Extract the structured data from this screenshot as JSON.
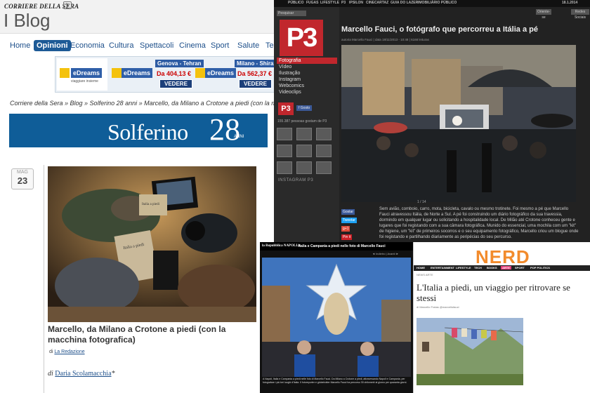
{
  "corriere": {
    "masthead": "CORRIERE DELLA SERA",
    "blog_title": "I Blog",
    "nav": [
      "Home",
      "Opinioni",
      "Economia",
      "Cultura",
      "Spettacoli",
      "Cinema",
      "Sport",
      "Salute",
      "Tec"
    ],
    "nav_active": "Opinioni",
    "ads": [
      {
        "logo": "eDreams",
        "tagline": "viaggiare insieme"
      },
      {
        "logo": "eDreams",
        "route": "Genova - Tehran",
        "price": "Da 404,13 €",
        "button": "VEDERE"
      },
      {
        "logo": "eDreams",
        "route": "Milano - Shiraz",
        "price": "Da 562,37 €",
        "button": "VEDERE"
      }
    ],
    "breadcrumb": "Corriere della Sera » Blog » Solferino 28 anni » Marcello, da Milano a Crotone a piedi (con la macchina",
    "section_banner": {
      "word": "Solferino",
      "number": "28",
      "sub": "ANNI"
    },
    "date": {
      "month": "MAG",
      "day": "23"
    },
    "post_title": "Marcello, da Milano a Crotone a piedi (con la macchina fotografica)",
    "byline_prefix": "di",
    "byline_author": "La Redazione",
    "author_prefix": "di",
    "author_name": "Daria Scolamacchia",
    "author_suffix": "*",
    "photo_labels": [
      "Italia a piedi",
      "Italia a piedi"
    ]
  },
  "p3": {
    "topnav": [
      "PÚBLICO",
      "FUGAS",
      "LIFESTYLE",
      "P3",
      "IPSILON",
      "CINECARTAZ",
      "GUIA DO LAZER",
      "IMOBILIÁRIO PÚBLICO"
    ],
    "date": "18.1.2014",
    "search_placeholder": "Pesquisar",
    "logo": "P3",
    "menu": [
      "Fotografia",
      "Vídeo",
      "Ilustração",
      "Instagram",
      "Webcomics",
      "Videoclips"
    ],
    "menu_active": "Fotografia",
    "header_buttons": [
      "Oriente-se",
      "Redes Sociais"
    ],
    "fb_label": "Gosto",
    "fans": "155.387 pessoas gostam de P3",
    "instagram": "INSTAGRAM P3",
    "article_title": "Marcello Fauci, o fotógrafo que percorreu a Itália a pé",
    "meta": "autoria Marcello Fauci  |  data 18/11/2013 - 10:48  |  6168 leituras",
    "counter": "1 / 14",
    "share": [
      "Gostar",
      "Tweetar",
      "g+1",
      "Pin it"
    ],
    "body": "Sem avião, comboio, carro, mota, bicicleta, cavalo ou mesmo trotinete. Foi mesmo a pé que Marcello Fauci atravessou Itália, de Norte a Sul. A pé foi construindo um diário fotográfico da sua travessia, dormindo em qualquer lugar ou solicitando a hospitalidade local. De Milão até Crotone conheceu gente e lugares que foi registando com a sua câmara fotográfica. Munido do essencial, uma mochila com um \"kit\" de higiene, um \"kit\" de primeiros socorros e o seu equipamento fotográfico, Marcello criou um blogue onde foi registando e partilhando diariamente as peripécias do seu percurso."
  },
  "repubblica": {
    "brand": "la Repubblica NAPOLI.it",
    "headline": "Italia e Campania a piedi nelle foto di Marcello Fauci",
    "controls": "◄ Indietro   |   Avanti ►",
    "caption": "A Napoli, Italia e Campania a piedi nelle foto di Marcello Fauci. Da Milano a Crotone a piedi, attraversando Napoli e Campania, per fotografare i più bei luoghi d'Italia. Il fotoreporter e globetrotter Marcello Fauci ha percorso 30 chilometri al giorno per quaranta giorni."
  },
  "nerd": {
    "logo": "NERD",
    "menu": [
      "HOME",
      "ENTERTAINMENT",
      "LIFESTYLE",
      "TECH",
      "BOOKS",
      "ARTE",
      "SPORT",
      "POP POLITICS"
    ],
    "menu_highlight": "ARTE",
    "sub": "NEWS    ARTE",
    "title": "L'Italia a piedi, un viaggio per ritrovare se stessi",
    "byline": "di Marcello Fratas    @marcellofauci"
  },
  "colors": {
    "corriere_blue": "#1d5a96",
    "p3_red": "#c1272d",
    "nerd_pink": "#e63e7a"
  }
}
